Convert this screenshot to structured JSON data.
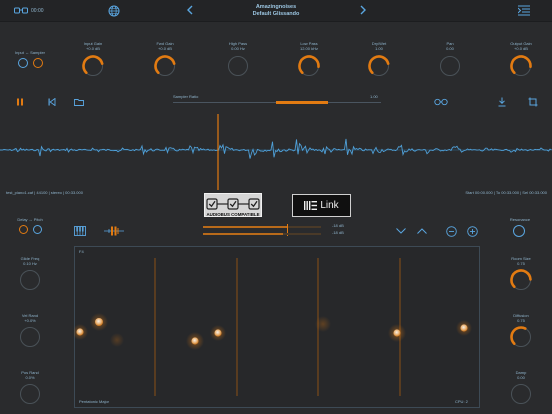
{
  "header": {
    "time": "00:00",
    "title": "Amazingnoises",
    "preset": "Default Glissando"
  },
  "controls": {
    "input_sampler": "Input ↔ Sampler",
    "knobs": [
      {
        "label": "Input Gain",
        "value": "+0.0 dB",
        "level": 0.78
      },
      {
        "label": "Fwd Gain",
        "value": "+0.0 dB",
        "level": 0.78
      },
      {
        "label": "High Pass",
        "value": "0.00 Hz",
        "level": 0.0
      },
      {
        "label": "Low Pass",
        "value": "12.00 kHz",
        "level": 0.85
      },
      {
        "label": "Dry/Wet",
        "value": "1.00",
        "level": 0.78
      },
      {
        "label": "Pan",
        "value": "0.00",
        "level": 0.0
      },
      {
        "label": "Output Gain",
        "value": "+0.0 dB",
        "level": 0.85
      }
    ]
  },
  "transport": {
    "sampler_ratio_label": "Sampler Ratio",
    "sampler_ratio_value": "1.00",
    "sampler_ratio_level": 0.25
  },
  "file": {
    "info": "test_piano1.caf | 44100 | stereo | 00:33.000",
    "times": "Start 00:00.000 | To 00:33.000 | Sel 00:33.000"
  },
  "badges": {
    "audiobus": "AUDIOBUS COMPATIBLE",
    "link": "Link"
  },
  "meters": {
    "top": "-18 dB",
    "bottom": "-18 dB"
  },
  "left_panel": {
    "delay_pitch": "Delay ↔ Pitch",
    "knobs": [
      {
        "label": "Glide Freq",
        "value": "0.10 Hz",
        "level": 0.0
      },
      {
        "label": "Vel Rand",
        "value": "+0.0%",
        "level": 0.0
      },
      {
        "label": "Pos Rand",
        "value": "0.0%",
        "level": 0.0
      }
    ]
  },
  "right_panel": {
    "resonance": "Resonance",
    "knobs": [
      {
        "label": "Room Size",
        "value": "0.75",
        "level": 0.82
      },
      {
        "label": "Diffusion",
        "value": "0.75",
        "level": 0.6
      },
      {
        "label": "Damp",
        "value": "0.00",
        "level": 0.0
      }
    ]
  },
  "pad": {
    "top_left": "F4",
    "bottom_left": "Pentatonic Major",
    "bottom_right": "CPU: 2"
  },
  "colors": {
    "accent": "#e27b12",
    "blue": "#5aa6e0",
    "bg": "#2a2b2d"
  }
}
